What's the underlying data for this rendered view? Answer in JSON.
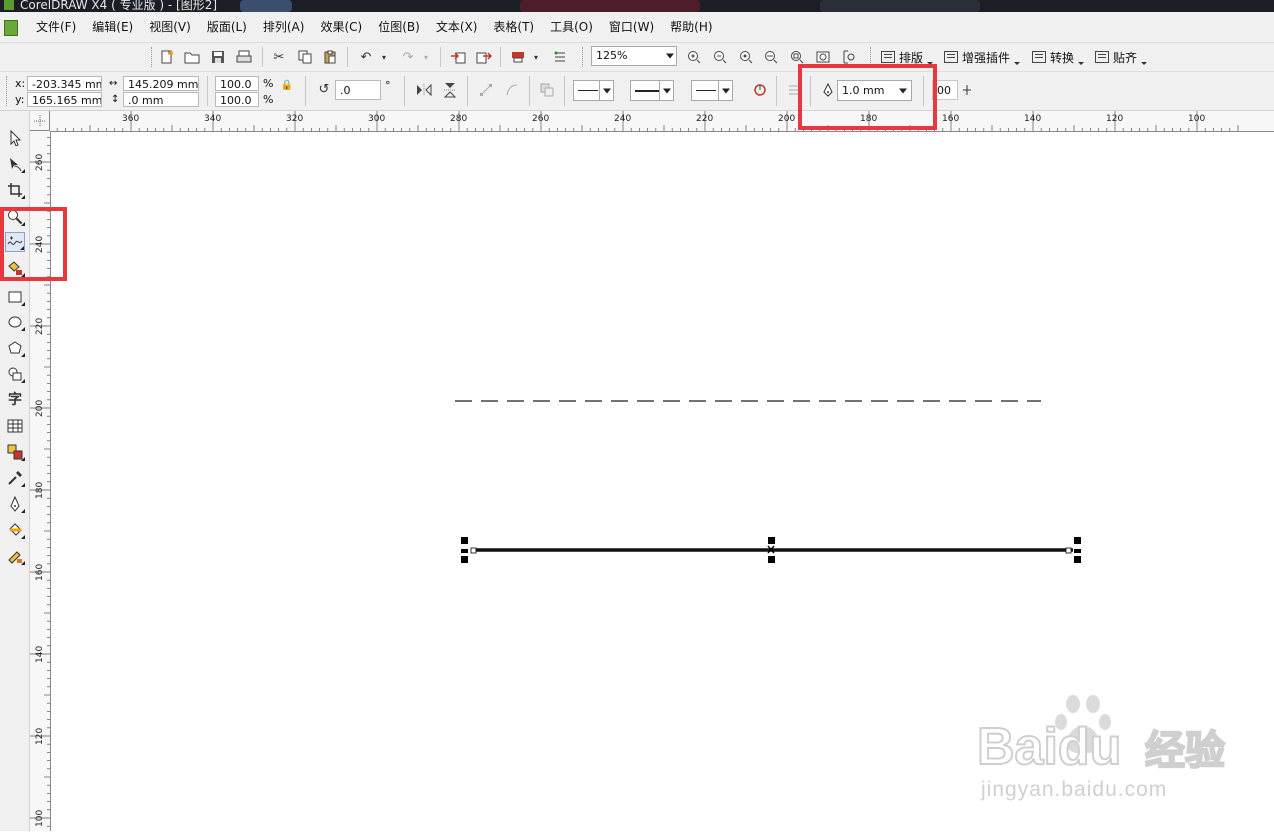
{
  "window": {
    "title": "CorelDRAW X4 ( 专业版 ) - [图形2]"
  },
  "menu": [
    {
      "label": "文件(F)"
    },
    {
      "label": "编辑(E)"
    },
    {
      "label": "视图(V)"
    },
    {
      "label": "版面(L)"
    },
    {
      "label": "排列(A)"
    },
    {
      "label": "效果(C)"
    },
    {
      "label": "位图(B)"
    },
    {
      "label": "文本(X)"
    },
    {
      "label": "表格(T)"
    },
    {
      "label": "工具(O)"
    },
    {
      "label": "窗口(W)"
    },
    {
      "label": "帮助(H)"
    }
  ],
  "standard_toolbar": {
    "zoom_value": "125%",
    "plugins": [
      {
        "label": "排版"
      },
      {
        "label": "增强插件"
      },
      {
        "label": "转换"
      },
      {
        "label": "贴齐"
      }
    ]
  },
  "property_bar": {
    "x_label": "x:",
    "x_value": "-203.345 mm",
    "y_label": "y:",
    "y_value": "165.165 mm",
    "width_value": "145.209 mm",
    "height_value": ".0 mm",
    "scale_w": "100.0",
    "scale_h": "100.0",
    "percent": "%",
    "rotation": ".0",
    "degree": "°",
    "outline_width": "1.0 mm",
    "miter_value": "00"
  },
  "ruler": {
    "top_ticks": [
      "360",
      "340",
      "320",
      "300",
      "280",
      "260",
      "240",
      "220",
      "200",
      "180",
      "160",
      "140",
      "120",
      "100"
    ],
    "left_ticks": [
      "260",
      "240",
      "220",
      "200",
      "180",
      "160",
      "140",
      "120",
      "100"
    ]
  },
  "watermark": {
    "brand": "Baidu",
    "product": "经验",
    "url": "jingyan.baidu.com"
  },
  "colors": {
    "highlight": "#e8373f",
    "menu_bg": "#f0f0f0",
    "title_bg": "#1b1f25"
  }
}
